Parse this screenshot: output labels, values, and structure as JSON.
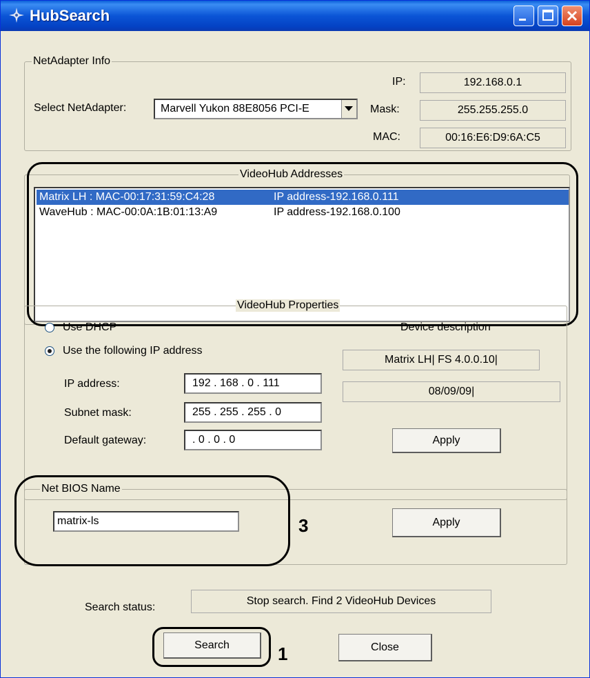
{
  "window": {
    "title": "HubSearch"
  },
  "netadapter": {
    "group_label": "NetAdapter Info",
    "select_label": "Select NetAdapter:",
    "selected": "Marvell Yukon 88E8056 PCI-E",
    "ip_label": "IP:",
    "ip": "192.168.0.1",
    "mask_label": "Mask:",
    "mask": "255.255.255.0",
    "mac_label": "MAC:",
    "mac": "00:16:E6:D9:6A:C5"
  },
  "addresses": {
    "group_label": "VideoHub Addresses",
    "items": [
      {
        "mac": "Matrix LH   : MAC-00:17:31:59:C4:28",
        "ip": "IP address-192.168.0.111",
        "selected": true
      },
      {
        "mac": "WaveHub : MAC-00:0A:1B:01:13:A9",
        "ip": "IP address-192.168.0.100",
        "selected": false
      }
    ]
  },
  "properties": {
    "group_label": "VideoHub Properties",
    "use_dhcp": "Use DHCP",
    "use_static": "Use the following IP address",
    "ip_label": "IP address:",
    "ip_value": "192 . 168 .   0  . 111",
    "subnet_label": "Subnet mask:",
    "subnet_value": "255 . 255 . 255 .   0",
    "gateway_label": "Default gateway:",
    "gateway_value": "   .   0  .   0  .   0",
    "device_desc_label": "Device description",
    "device_desc1": "Matrix LH| FS 4.0.0.10|",
    "device_desc2": "08/09/09|",
    "apply_label": "Apply"
  },
  "netbios": {
    "group_label": "Net BIOS Name",
    "value": "matrix-ls",
    "apply_label": "Apply"
  },
  "status": {
    "label": "Search status:",
    "value": "Stop search. Find 2 VideoHub Devices"
  },
  "buttons": {
    "search": "Search",
    "close": "Close"
  },
  "callouts": {
    "c1": "1",
    "c3": "3"
  }
}
